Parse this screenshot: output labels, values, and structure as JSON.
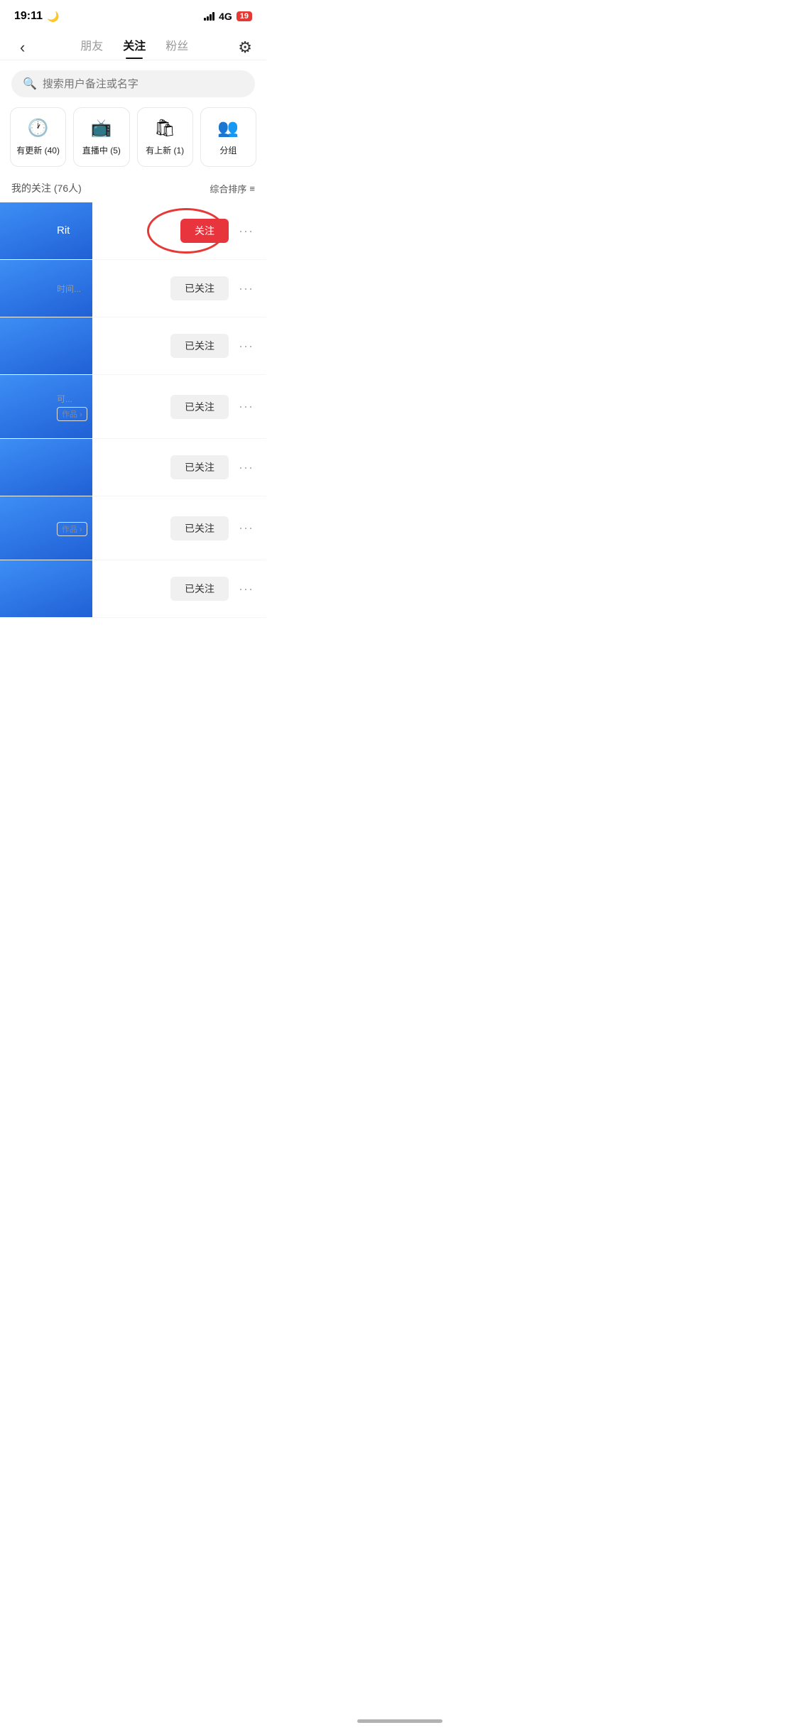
{
  "statusBar": {
    "time": "19:11",
    "moonIcon": "🌙",
    "battery": "19"
  },
  "nav": {
    "tabs": [
      {
        "id": "friends",
        "label": "朋友",
        "active": false
      },
      {
        "id": "following",
        "label": "关注",
        "active": true
      },
      {
        "id": "fans",
        "label": "粉丝",
        "active": false
      }
    ],
    "settingsIcon": "⚙"
  },
  "search": {
    "placeholder": "搜索用户备注或名字"
  },
  "categories": [
    {
      "id": "updates",
      "icon": "🕐",
      "label": "有更新 (40)"
    },
    {
      "id": "live",
      "icon": "📺",
      "label": "直播中 (5)"
    },
    {
      "id": "newItems",
      "icon": "🛍",
      "label": "有上新 (1)"
    },
    {
      "id": "group",
      "icon": "👥",
      "label": "分组"
    }
  ],
  "sectionHeader": {
    "title": "我的关注 (76人)",
    "sortLabel": "综合排序"
  },
  "users": [
    {
      "id": 1,
      "name": "Rit",
      "desc": "",
      "followStatus": "follow",
      "followLabel": "关注",
      "hasCircle": true
    },
    {
      "id": 2,
      "name": "",
      "desc": "时间...",
      "followStatus": "followed",
      "followLabel": "已关注",
      "hasCircle": false
    },
    {
      "id": 3,
      "name": "",
      "desc": "",
      "followStatus": "followed",
      "followLabel": "已关注",
      "hasCircle": false
    },
    {
      "id": 4,
      "name": "",
      "desc": "可...",
      "followStatus": "followed",
      "followLabel": "已关注",
      "hasWorks": true,
      "hasCircle": false
    },
    {
      "id": 5,
      "name": "",
      "desc": "",
      "followStatus": "followed",
      "followLabel": "已关注",
      "hasCircle": false
    },
    {
      "id": 6,
      "name": "",
      "desc": "",
      "followStatus": "followed",
      "followLabel": "已关注",
      "hasWorks": true,
      "hasCircle": false
    },
    {
      "id": 7,
      "name": "",
      "desc": "",
      "followStatus": "followed",
      "followLabel": "已关注",
      "hasCircle": false
    }
  ],
  "worksLabel": "作品 ›",
  "moreLabel": "···"
}
